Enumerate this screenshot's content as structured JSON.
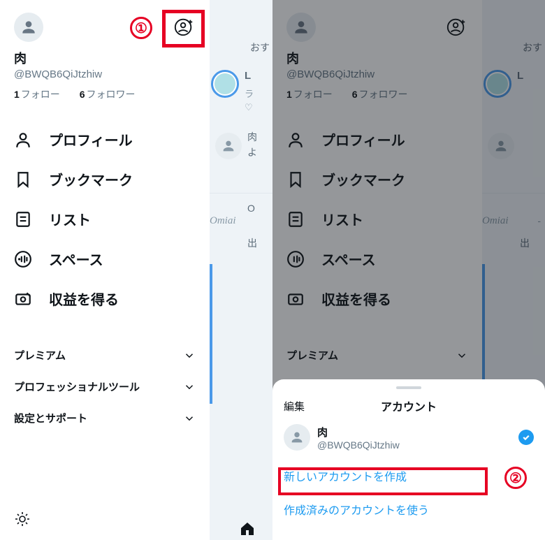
{
  "profile": {
    "name": "肉",
    "handle": "@BWQB6QiJtzhiw",
    "following_count": "1",
    "following_label": "フォロー",
    "followers_count": "6",
    "followers_label": "フォロワー"
  },
  "menu": {
    "profile": "プロフィール",
    "bookmarks": "ブックマーク",
    "lists": "リスト",
    "spaces": "スペース",
    "monetization": "収益を得る"
  },
  "expand": {
    "premium": "プレミアム",
    "professional": "プロフェッショナルツール",
    "settings": "設定とサポート"
  },
  "sheet": {
    "edit": "編集",
    "title": "アカウント",
    "account_name": "肉",
    "account_handle": "@BWQB6QiJtzhiw",
    "create_new": "新しいアカウントを作成",
    "use_existing": "作成済みのアカウントを使う"
  },
  "bg": {
    "recommended_tab": "おす",
    "initial": "L",
    "sub1": "ラ",
    "sub2": "肉",
    "sub3": "よ",
    "ad_label": "Omiai",
    "sub4": "出",
    "sub5": "O",
    "dash": "-"
  },
  "annotations": {
    "step1": "①",
    "step2": "②"
  }
}
